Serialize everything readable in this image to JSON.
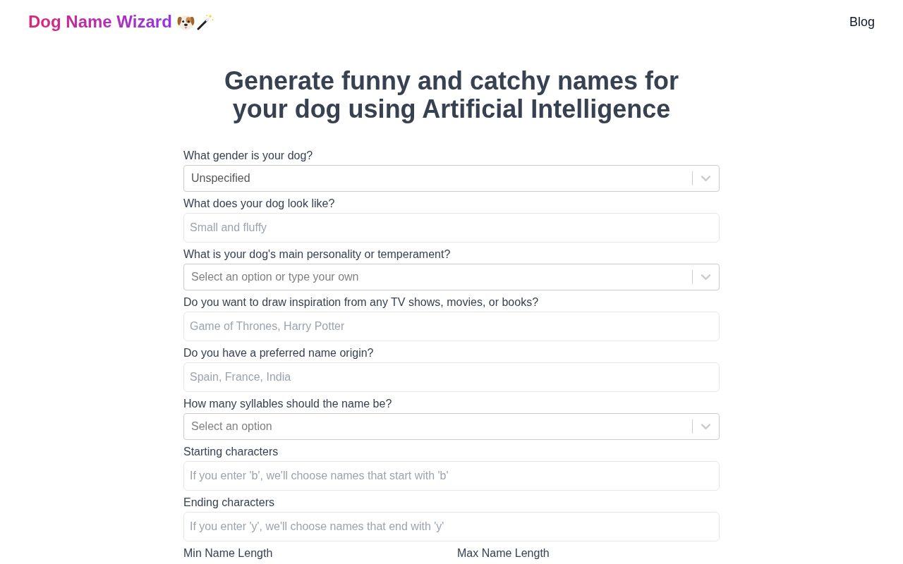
{
  "header": {
    "logo": "Dog Name Wizard",
    "nav_links": [
      "Blog"
    ]
  },
  "headline": "Generate funny and catchy names for your dog using Artificial Intelligence",
  "form": {
    "fields": [
      {
        "kind": "select",
        "label": "What gender is your dog?",
        "value": "Unspecified"
      },
      {
        "kind": "text",
        "label": "What does your dog look like?",
        "placeholder": "Small and fluffy"
      },
      {
        "kind": "select",
        "label": "What is your dog's main personality or temperament?",
        "placeholder": "Select an option or type your own"
      },
      {
        "kind": "text",
        "label": "Do you want to draw inspiration from any TV shows, movies, or books?",
        "placeholder": "Game of Thrones, Harry Potter"
      },
      {
        "kind": "text",
        "label": "Do you have a preferred name origin?",
        "placeholder": "Spain, France, India"
      },
      {
        "kind": "select",
        "label": "How many syllables should the name be?",
        "placeholder": "Select an option"
      },
      {
        "kind": "text",
        "label": "Starting characters",
        "placeholder": "If you enter 'b', we'll choose names that start with 'b'"
      },
      {
        "kind": "text",
        "label": "Ending characters",
        "placeholder": "If you enter 'y', we'll choose names that end with 'y'"
      }
    ],
    "length_labels": [
      "Min Name Length",
      "Max Name Length"
    ]
  }
}
